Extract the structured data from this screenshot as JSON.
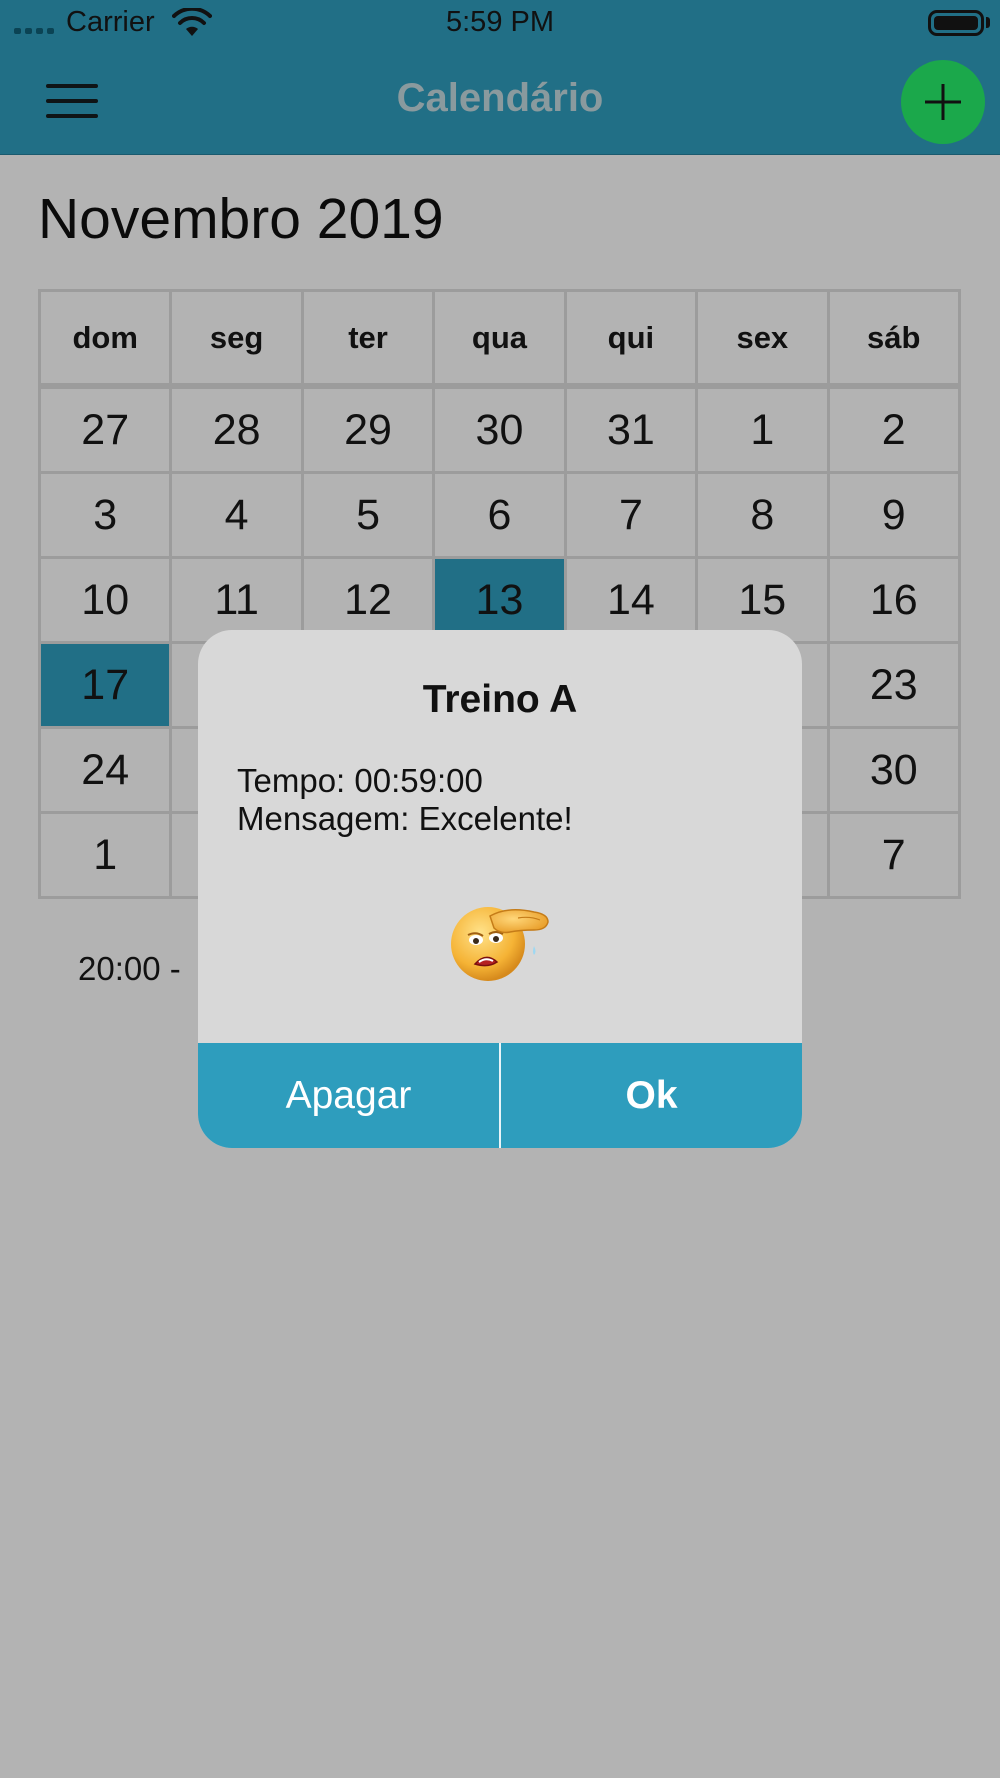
{
  "status_bar": {
    "carrier": "Carrier",
    "time": "5:59 PM",
    "icons": [
      "signal-dots-icon",
      "wifi-icon",
      "battery-icon"
    ]
  },
  "app_bar": {
    "title": "Calendário",
    "menu_icon": "hamburger-menu-icon",
    "add_icon": "plus-icon",
    "colors": {
      "bar": "#216f86",
      "add_button": "#1ba84b"
    }
  },
  "calendar": {
    "month_title": "Novembro 2019",
    "weekdays": [
      "dom",
      "seg",
      "ter",
      "qua",
      "qui",
      "sex",
      "sáb"
    ],
    "weeks": [
      [
        "27",
        "28",
        "29",
        "30",
        "31",
        "1",
        "2"
      ],
      [
        "3",
        "4",
        "5",
        "6",
        "7",
        "8",
        "9"
      ],
      [
        "10",
        "11",
        "12",
        "13",
        "14",
        "15",
        "16"
      ],
      [
        "17",
        "",
        "",
        "",
        "",
        "",
        "23"
      ],
      [
        "24",
        "",
        "",
        "",
        "",
        "",
        "30"
      ],
      [
        "1",
        "",
        "",
        "",
        "",
        "",
        "7"
      ]
    ],
    "selected_days": [
      "13",
      "17"
    ],
    "selected_color": "#216f86",
    "event_preview": "20:00 -"
  },
  "dialog": {
    "title": "Treino A",
    "time_line": "Tempo: 00:59:00",
    "message_line": "Mensagem: Excelente!",
    "emoji_icon": "exhausted-face-icon",
    "delete_label": "Apagar",
    "ok_label": "Ok",
    "button_color": "#2e9dbd"
  }
}
